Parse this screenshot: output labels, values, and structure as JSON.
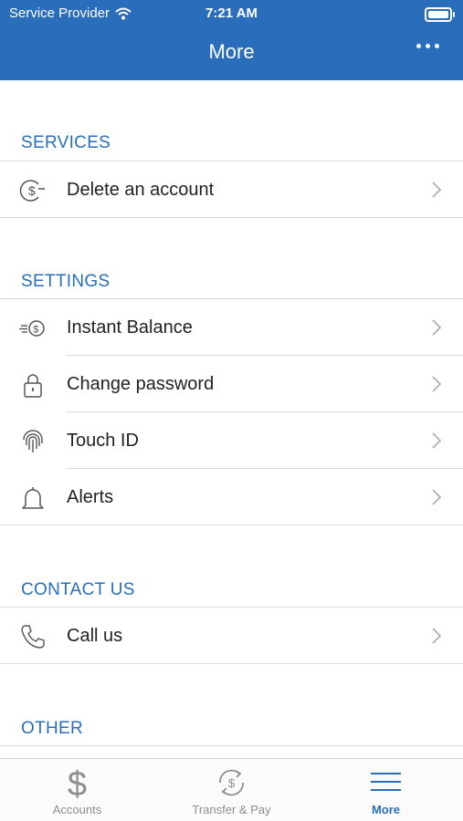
{
  "status_bar": {
    "carrier": "Service Provider",
    "time": "7:21 AM"
  },
  "nav": {
    "title": "More",
    "menu_icon": "more-dots-icon"
  },
  "sections": [
    {
      "header": "SERVICES",
      "items": [
        {
          "label": "Delete an account",
          "icon": "dollar-circle-icon"
        }
      ]
    },
    {
      "header": "SETTINGS",
      "items": [
        {
          "label": "Instant Balance",
          "icon": "instant-balance-icon"
        },
        {
          "label": "Change password",
          "icon": "lock-icon"
        },
        {
          "label": "Touch ID",
          "icon": "fingerprint-icon"
        },
        {
          "label": "Alerts",
          "icon": "bell-icon"
        }
      ]
    },
    {
      "header": "CONTACT US",
      "items": [
        {
          "label": "Call us",
          "icon": "phone-icon"
        }
      ]
    },
    {
      "header": "OTHER",
      "items": []
    }
  ],
  "tabbar": {
    "tabs": [
      {
        "label": "Accounts",
        "icon": "dollar-icon",
        "active": false
      },
      {
        "label": "Transfer & Pay",
        "icon": "transfer-icon",
        "active": false
      },
      {
        "label": "More",
        "icon": "hamburger-icon",
        "active": true
      }
    ]
  },
  "colors": {
    "accent": "#2a6ebb",
    "separator": "#d8d8d8",
    "tab_inactive": "#8e8e8e"
  }
}
